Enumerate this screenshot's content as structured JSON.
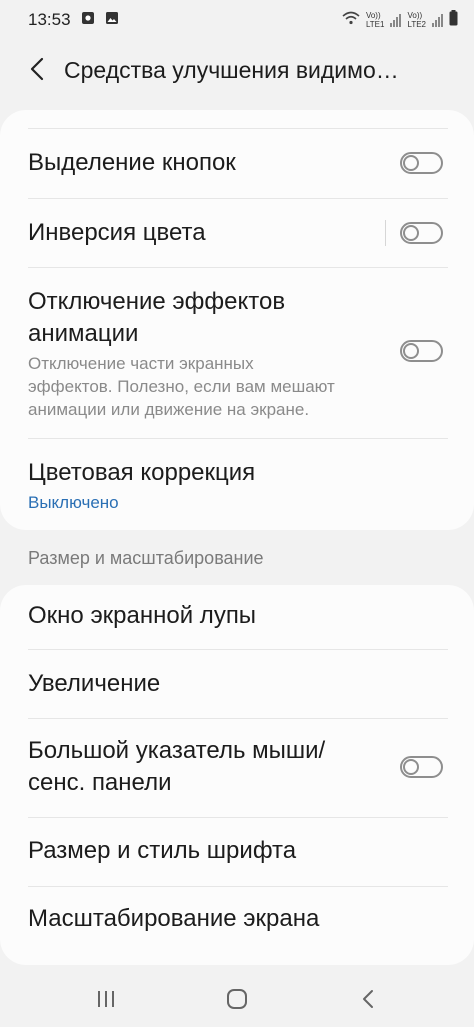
{
  "status": {
    "time": "13:53",
    "network1": {
      "top": "Vo))",
      "bottom": "LTE1"
    },
    "network2": {
      "top": "Vo))",
      "bottom": "LTE2"
    }
  },
  "header": {
    "title": "Средства улучшения видимо…"
  },
  "card1": {
    "items": [
      {
        "title": "Выделение кнопок",
        "toggle": false
      },
      {
        "title": "Инверсия цвета",
        "toggle": false
      },
      {
        "title_line1": "Отключение эффектов",
        "title_line2": "анимации",
        "desc_line1": "Отключение части экранных",
        "desc_line2": "эффектов. Полезно, если вам мешают",
        "desc_line3": "анимации или движение на экране.",
        "toggle": false
      },
      {
        "title": "Цветовая коррекция",
        "subtitle": "Выключено"
      }
    ]
  },
  "section": {
    "title": "Размер и масштабирование"
  },
  "card2": {
    "items": [
      {
        "title": "Окно экранной лупы"
      },
      {
        "title": "Увеличение"
      },
      {
        "title_line1": "Большой указатель мыши/",
        "title_line2": "сенс. панели",
        "toggle": false
      },
      {
        "title": "Размер и стиль шрифта"
      },
      {
        "title": "Масштабирование экрана"
      }
    ]
  },
  "colors": {
    "accent": "#2a6fb4",
    "background": "#f2f2f2",
    "card": "#fcfcfc",
    "secondary_text": "#8a8a8a"
  },
  "icons": {
    "back": "chevron-left-icon",
    "recents": "recents-icon",
    "home": "home-icon",
    "nav_back": "nav-back-icon"
  }
}
